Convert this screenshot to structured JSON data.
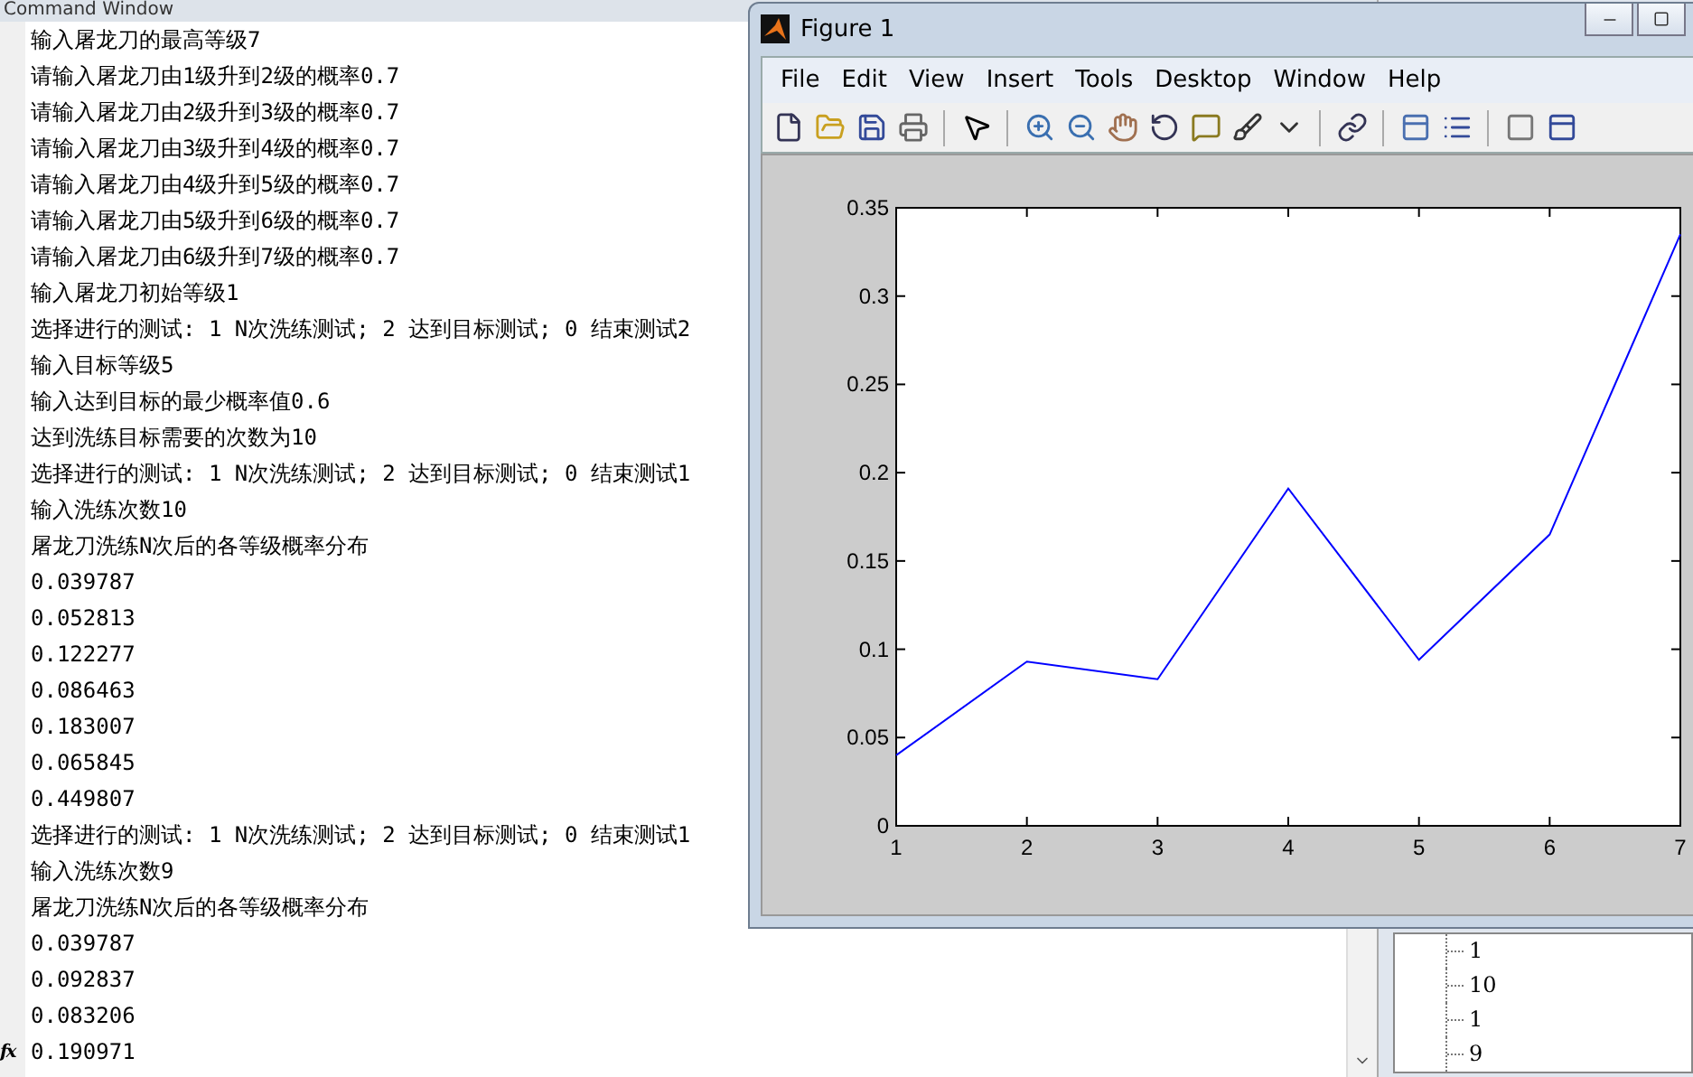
{
  "command_window": {
    "title": "Command Window",
    "lines": [
      "输入屠龙刀的最高等级7",
      "请输入屠龙刀由1级升到2级的概率0.7",
      "请输入屠龙刀由2级升到3级的概率0.7",
      "请输入屠龙刀由3级升到4级的概率0.7",
      "请输入屠龙刀由4级升到5级的概率0.7",
      "请输入屠龙刀由5级升到6级的概率0.7",
      "请输入屠龙刀由6级升到7级的概率0.7",
      "输入屠龙刀初始等级1",
      "选择进行的测试: 1 N次洗练测试; 2 达到目标测试; 0 结束测试2",
      "输入目标等级5",
      "输入达到目标的最少概率值0.6",
      "达到洗练目标需要的次数为10",
      "选择进行的测试: 1 N次洗练测试; 2 达到目标测试; 0 结束测试1",
      "输入洗练次数10",
      "屠龙刀洗练N次后的各等级概率分布",
      "0.039787",
      "0.052813",
      "0.122277",
      "0.086463",
      "0.183007",
      "0.065845",
      "0.449807",
      "选择进行的测试: 1 N次洗练测试; 2 达到目标测试; 0 结束测试1",
      "输入洗练次数9",
      "屠龙刀洗练N次后的各等级概率分布",
      "0.039787",
      "0.092837",
      "0.083206",
      "0.190971"
    ]
  },
  "prompt_icon": "fx",
  "workspace": {
    "tree_items": [
      "1",
      "10",
      "1",
      "9"
    ]
  },
  "figure": {
    "title": "Figure 1",
    "menu": [
      "File",
      "Edit",
      "View",
      "Insert",
      "Tools",
      "Desktop",
      "Window",
      "Help"
    ],
    "chart_data": {
      "type": "line",
      "x": [
        1,
        2,
        3,
        4,
        5,
        6,
        7
      ],
      "series": [
        {
          "color": "#0000ff",
          "values": [
            0.04,
            0.093,
            0.083,
            0.191,
            0.094,
            0.165,
            0.335
          ]
        }
      ],
      "xlim": [
        1,
        7
      ],
      "ylim": [
        0,
        0.35
      ],
      "xticks": [
        1,
        2,
        3,
        4,
        5,
        6,
        7
      ],
      "yticks": [
        {
          "value": 0,
          "label": "0"
        },
        {
          "value": 0.05,
          "label": "0.05"
        },
        {
          "value": 0.1,
          "label": "0.1"
        },
        {
          "value": 0.15,
          "label": "0.15"
        },
        {
          "value": 0.2,
          "label": "0.2"
        },
        {
          "value": 0.25,
          "label": "0.25"
        },
        {
          "value": 0.3,
          "label": "0.3"
        },
        {
          "value": 0.35,
          "label": "0.35"
        }
      ]
    }
  }
}
